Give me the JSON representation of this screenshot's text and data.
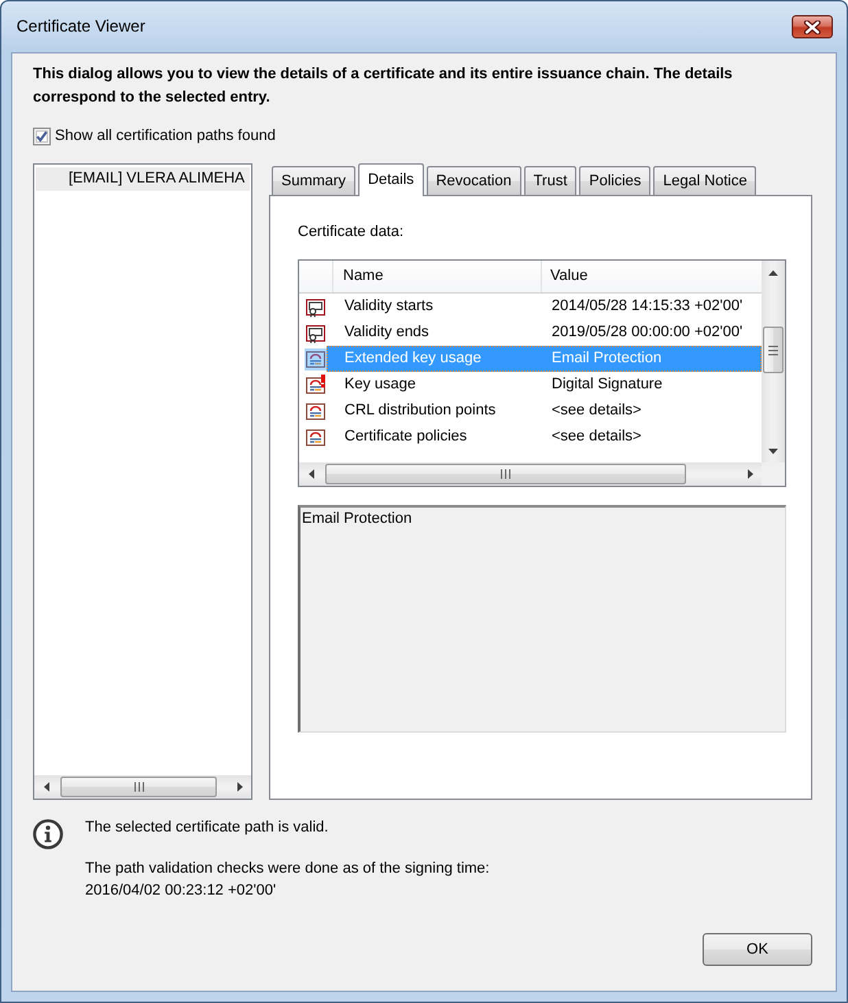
{
  "window": {
    "title": "Certificate Viewer"
  },
  "intro": "This dialog allows you to view the details of a certificate and its entire issuance chain. The details correspond to the selected entry.",
  "show_all_paths": {
    "label": "Show all certification paths found",
    "checked": true
  },
  "path_tree": {
    "items": [
      {
        "label": "[EMAIL] VLERA ALIMEHA",
        "selected": true
      }
    ]
  },
  "tabs": [
    {
      "label": "Summary",
      "selected": false
    },
    {
      "label": "Details",
      "selected": true
    },
    {
      "label": "Revocation",
      "selected": false
    },
    {
      "label": "Trust",
      "selected": false
    },
    {
      "label": "Policies",
      "selected": false
    },
    {
      "label": "Legal Notice",
      "selected": false
    }
  ],
  "details": {
    "label": "Certificate data:",
    "columns": [
      "Name",
      "Value"
    ],
    "rows": [
      {
        "kind": "validity",
        "name": "Validity starts",
        "value": "2014/05/28 14:15:33 +02'00'",
        "selected": false
      },
      {
        "kind": "validity",
        "name": "Validity ends",
        "value": "2019/05/28 00:00:00 +02'00'",
        "selected": false
      },
      {
        "kind": "extension",
        "name": "Extended key usage",
        "value": "Email Protection",
        "selected": true
      },
      {
        "kind": "warning",
        "name": "Key usage",
        "value": "Digital Signature",
        "selected": false
      },
      {
        "kind": "extension",
        "name": "CRL distribution points",
        "value": "<see details>",
        "selected": false
      },
      {
        "kind": "extension",
        "name": "Certificate policies",
        "value": "<see details>",
        "selected": false
      }
    ],
    "selected_value": "Email Protection"
  },
  "status": {
    "message": "The selected certificate path is valid.",
    "note": "The path validation checks were done as of the signing time:",
    "time": "2016/04/02 00:23:12 +02'00'"
  },
  "buttons": [
    "OK"
  ]
}
